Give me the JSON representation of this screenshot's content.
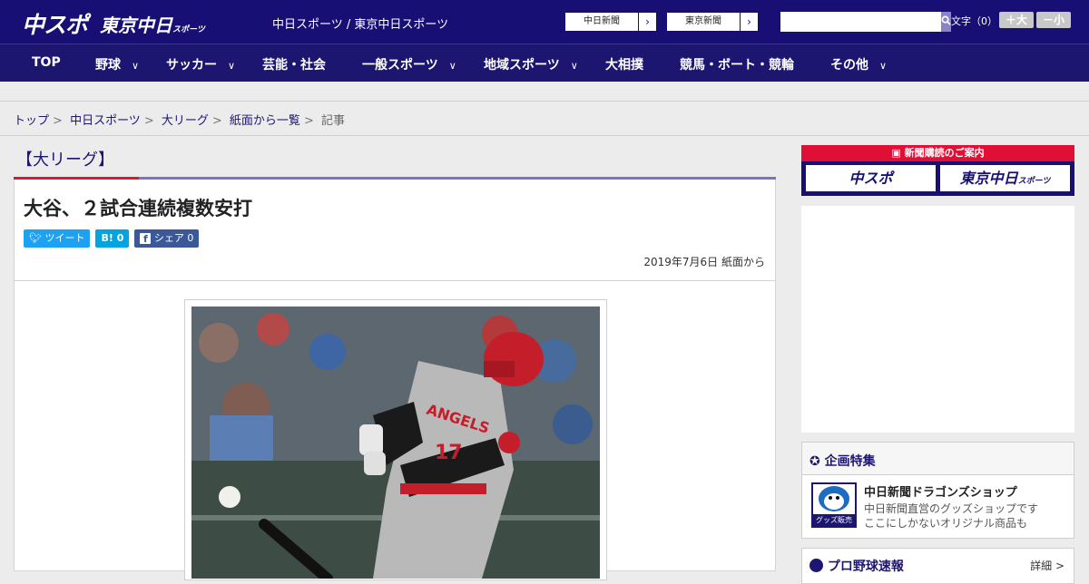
{
  "header": {
    "logo_main": "中スポ",
    "logo_tokyo": "東京中日",
    "logo_tokyo_small": "スポーツ",
    "site_title": "中日スポーツ / 東京中日スポーツ",
    "edition_buttons": [
      "中日新聞",
      "東京新聞"
    ],
    "search_placeholder": "",
    "font_size_label": "文字（0）",
    "font_larger": "＋大",
    "font_smaller": "－小"
  },
  "nav": {
    "items": [
      {
        "label": "TOP",
        "dropdown": false
      },
      {
        "label": "野球",
        "dropdown": true
      },
      {
        "label": "サッカー",
        "dropdown": true
      },
      {
        "label": "芸能・社会",
        "dropdown": false
      },
      {
        "label": "一般スポーツ",
        "dropdown": true
      },
      {
        "label": "地域スポーツ",
        "dropdown": true
      },
      {
        "label": "大相撲",
        "dropdown": false
      },
      {
        "label": "競馬・ボート・競輪",
        "dropdown": false
      },
      {
        "label": "その他",
        "dropdown": true
      }
    ]
  },
  "breadcrumb": [
    "トップ",
    "中日スポーツ",
    "大リーグ",
    "紙面から一覧",
    "記事"
  ],
  "article": {
    "category": "【大リーグ】",
    "headline": "大谷、２試合連続複数安打",
    "share": {
      "tweet": "ツイート",
      "hatena": "B! 0",
      "facebook": "シェア 0"
    },
    "date": "2019年7月6日 紙面から",
    "photo_jersey_text": "ANGELS",
    "photo_jersey_number": "17"
  },
  "sidebar": {
    "subscription_banner": "新聞購読のご案内",
    "subscription_logo_1": "中スポ",
    "subscription_logo_2": "東京中日",
    "subscription_logo_2_small": "スポーツ",
    "feature_heading": "企画特集",
    "feature_item": {
      "title": "中日新聞ドラゴンズショップ",
      "desc_line1": "中日新聞直営のグッズショップです",
      "desc_line2": "ここにしかないオリジナル商品も",
      "thumb_label": "グッズ販売中"
    },
    "score_heading": "プロ野球速報",
    "score_more": "詳細 >"
  },
  "colors": {
    "navy": "#170f73",
    "red": "#d11c38",
    "accent": "#7c74c0"
  }
}
